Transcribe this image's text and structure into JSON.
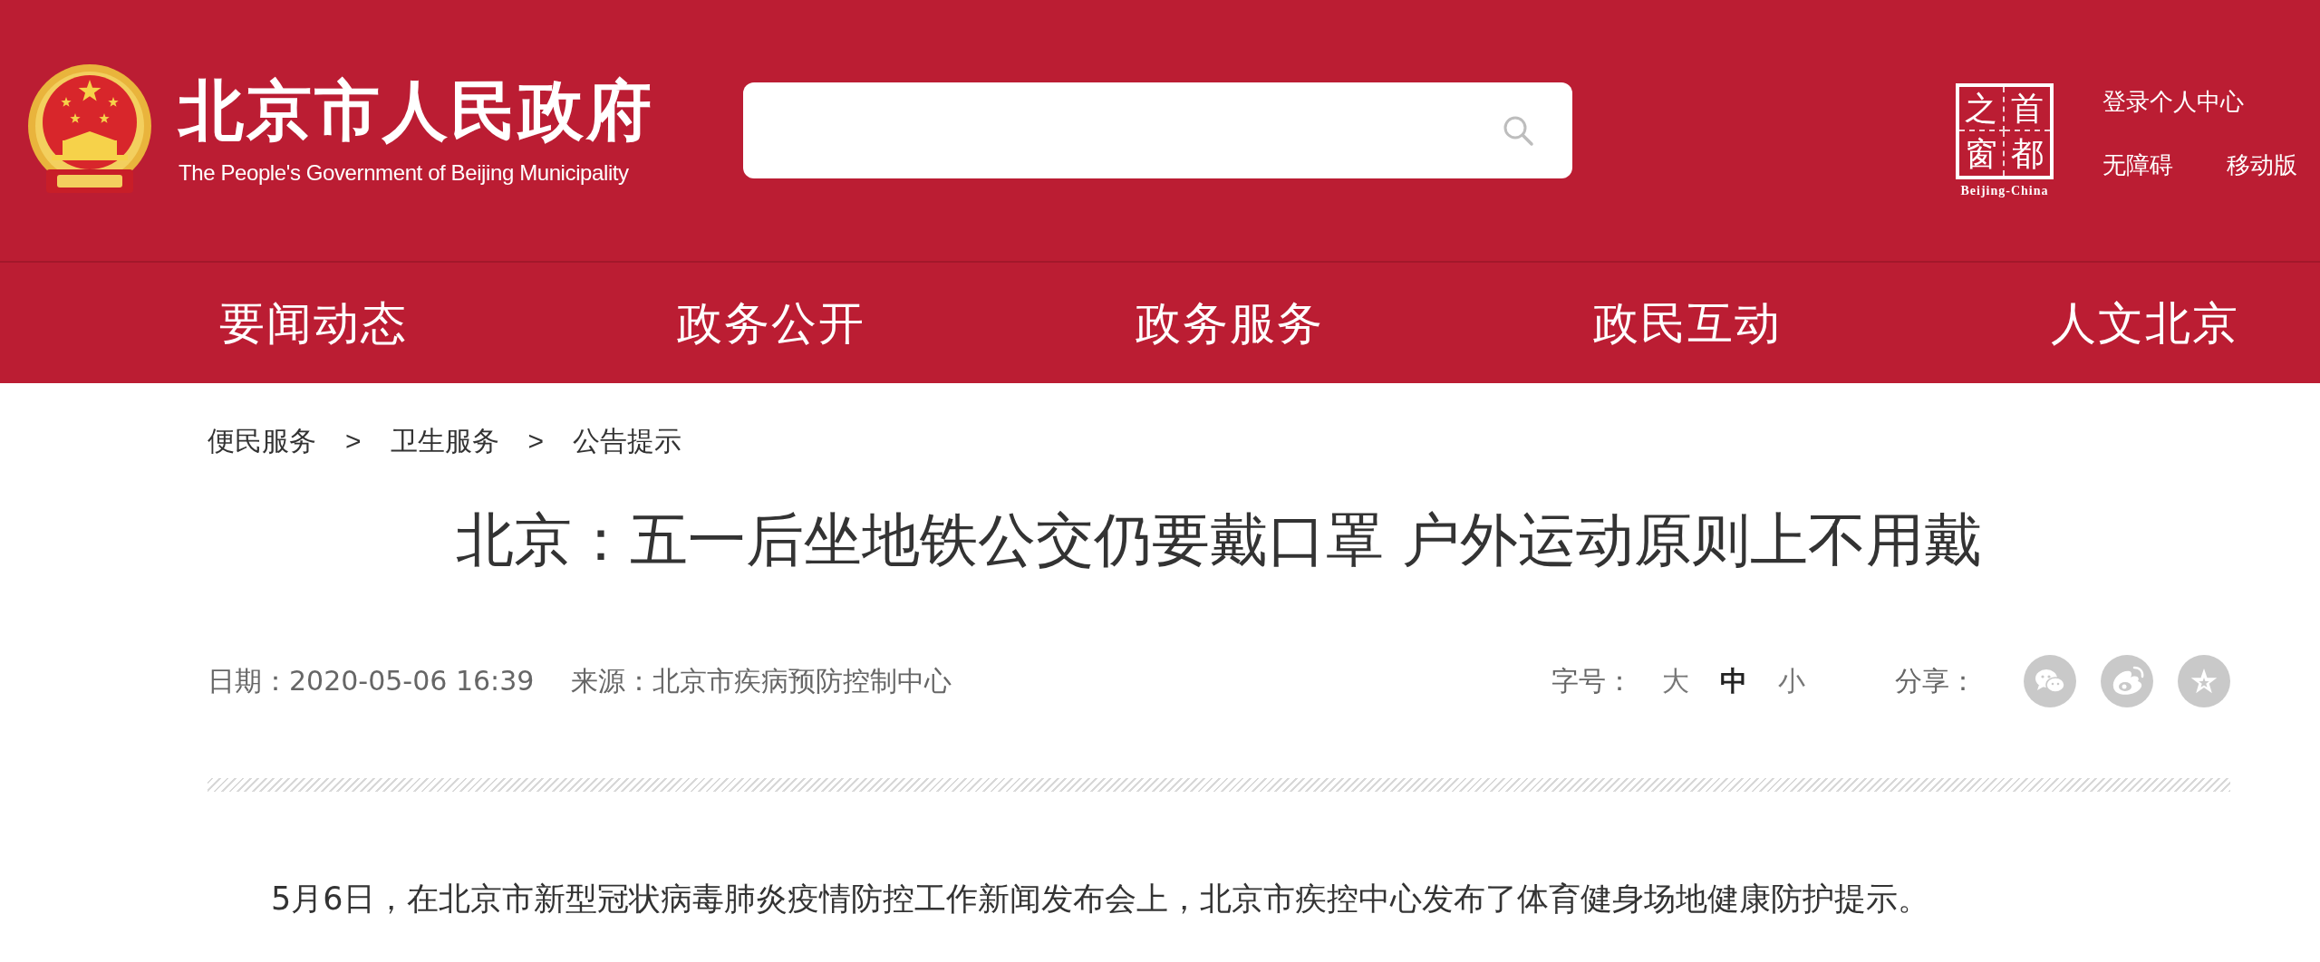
{
  "header": {
    "title": "北京市人民政府",
    "subtitle": "The People's Government of Beijing Municipality"
  },
  "portal_logo": {
    "characters": [
      "之",
      "首",
      "窗",
      "都"
    ],
    "caption": "Beijing-China"
  },
  "user_links": {
    "login": "登录个人中心",
    "links": [
      "无障碍",
      "移动版"
    ]
  },
  "nav": [
    "要闻动态",
    "政务公开",
    "政务服务",
    "政民互动",
    "人文北京"
  ],
  "breadcrumb": [
    {
      "label": "便民服务",
      "separator": ">"
    },
    {
      "label": "卫生服务",
      "separator": ">"
    },
    {
      "label": "公告提示"
    }
  ],
  "article": {
    "title": "北京：五一后坐地铁公交仍要戴口罩 户外运动原则上不用戴",
    "date": "日期：2020-05-06 16:39",
    "source": "来源：北京市疾病预防控制中心",
    "font_size": {
      "label": "字号：",
      "options": [
        {
          "label": "大",
          "selected": false
        },
        {
          "label": "中",
          "selected": true
        },
        {
          "label": "小",
          "selected": false
        }
      ]
    },
    "share": {
      "label": "分享：",
      "targets": [
        {
          "kind": "wechat"
        },
        {
          "kind": "weibo"
        },
        {
          "kind": "qzone"
        }
      ]
    },
    "paragraphs": [
      "5月6日，在北京市新型冠状病毒肺炎疫情防控工作新闻发布会上，北京市疾控中心发布了体育健身场地健康防护提示。"
    ]
  }
}
